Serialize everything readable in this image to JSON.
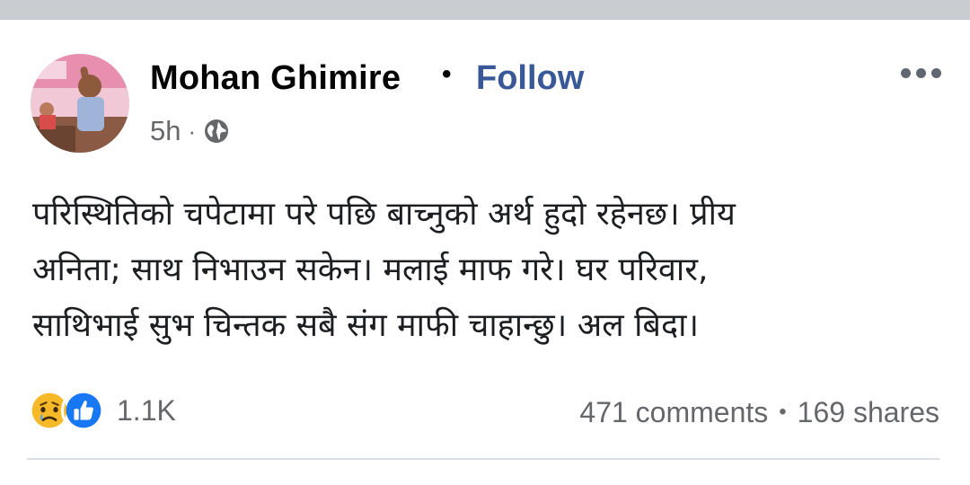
{
  "post": {
    "author_name": "Mohan Ghimire",
    "separator": "•",
    "follow_label": "Follow",
    "timestamp": "5h",
    "meta_separator": "·",
    "privacy_icon": "globe-icon",
    "more_icon": "more-options-icon",
    "text_lines": [
      "परिस्थितिको चपेटामा परे पछि बाच्नुको अर्थ हुदो रहेनछ। प्रीय",
      "अनिता; साथ निभाउन सकेन। मलाई माफ गरे।  घर परिवार,",
      "साथिभाई सुभ चिन्तक सबै संग माफी चाहान्छु। अल बिदा।"
    ]
  },
  "footer": {
    "reaction_icons": [
      "sad-reaction-icon",
      "like-reaction-icon"
    ],
    "reaction_count": "1.1K",
    "comments": "471 comments",
    "stats_separator": "•",
    "shares": "169 shares"
  },
  "colors": {
    "link": "#385898",
    "secondary_text": "#65676b",
    "like_blue": "#1877f2",
    "sad_yellow": "#f7b928",
    "top_strip": "#c9ccd1"
  }
}
